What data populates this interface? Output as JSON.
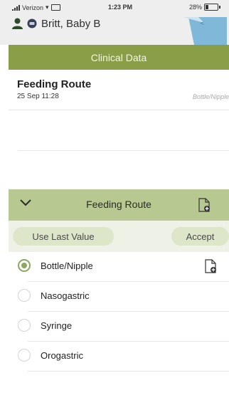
{
  "status_bar": {
    "carrier": "Verizon",
    "time": "1:23 PM",
    "battery": "28%",
    "battery_level": 0.28
  },
  "patient": {
    "name": "Britt, Baby B"
  },
  "header": {
    "title": "Clinical Data"
  },
  "history": {
    "title": "Feeding Route",
    "date": "25 Sep 11:28",
    "value": "Bottle/Nipple"
  },
  "section": {
    "title": "Feeding Route"
  },
  "actions": {
    "use_last_label": "Use Last Value",
    "accept_label": "Accept"
  },
  "options": [
    {
      "label": "Bottle/Nipple",
      "selected": true
    },
    {
      "label": "Nasogastric",
      "selected": false
    },
    {
      "label": "Syringe",
      "selected": false
    },
    {
      "label": "Orogastric",
      "selected": false
    }
  ],
  "colors": {
    "header_green": "#8a9e47",
    "section_green": "#b7c890",
    "radio_green": "#8aa85f",
    "tab_blue": "#7fb8d8"
  }
}
